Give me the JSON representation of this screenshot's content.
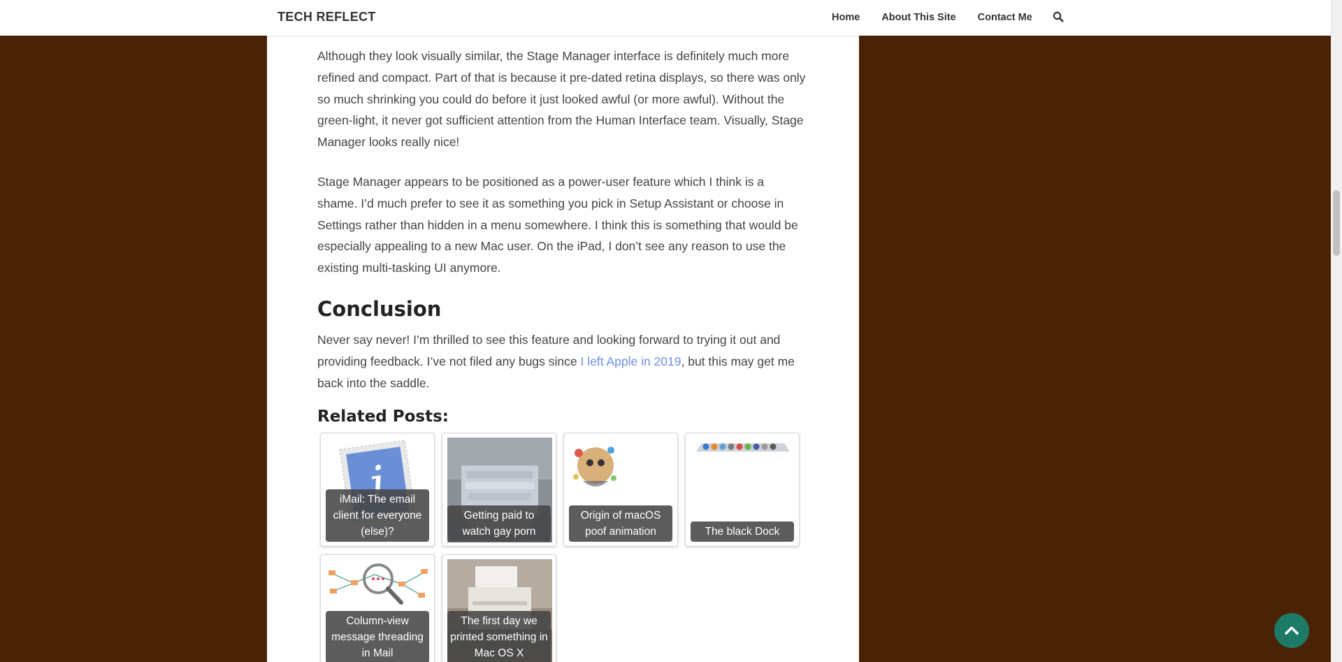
{
  "site": {
    "title": "TECH REFLECT"
  },
  "nav": {
    "items": [
      "Home",
      "About This Site",
      "Contact Me"
    ]
  },
  "article": {
    "p1": "Although they look visually similar, the Stage Manager interface is definitely much more refined and compact. Part of that is because it pre-dated retina displays, so there was only so much shrinking you could do before it just looked awful (or more awful). Without the green-light, it never got sufficient attention from the Human Interface team. Visually, Stage Manager looks really nice!",
    "p2": "Stage Manager appears to be positioned as a power-user feature which I think is a shame. I’d much prefer to see it as something you pick in Setup Assistant or choose in Settings rather than hidden in a menu somewhere. I think this is something that would be especially appealing to a new Mac user. On the iPad, I don’t see any reason to use the existing multi-tasking UI anymore.",
    "conclusion_heading": "Conclusion",
    "p3_before": "Never say never! I’m thrilled to see this feature and looking forward to trying it out and providing feedback. I’ve not filed any bugs since ",
    "p3_link": "I left Apple in 2019",
    "p3_after": ", but this may get me back into the saddle."
  },
  "related": {
    "title": "Related Posts:",
    "posts": [
      {
        "caption": "iMail: The email client for everyone (else)?"
      },
      {
        "caption": "Getting paid to watch gay porn"
      },
      {
        "caption": "Origin of macOS poof animation"
      },
      {
        "caption": "The black Dock"
      },
      {
        "caption": "Column-view message threading in Mail"
      },
      {
        "caption": "The first day we printed something in Mac OS X"
      }
    ]
  },
  "colors": {
    "background": "#4a2206",
    "link": "#6f8fe8",
    "accent": "#1d7a67"
  },
  "icons": {
    "search": "search-icon",
    "scroll_top": "chevron-up-icon"
  }
}
